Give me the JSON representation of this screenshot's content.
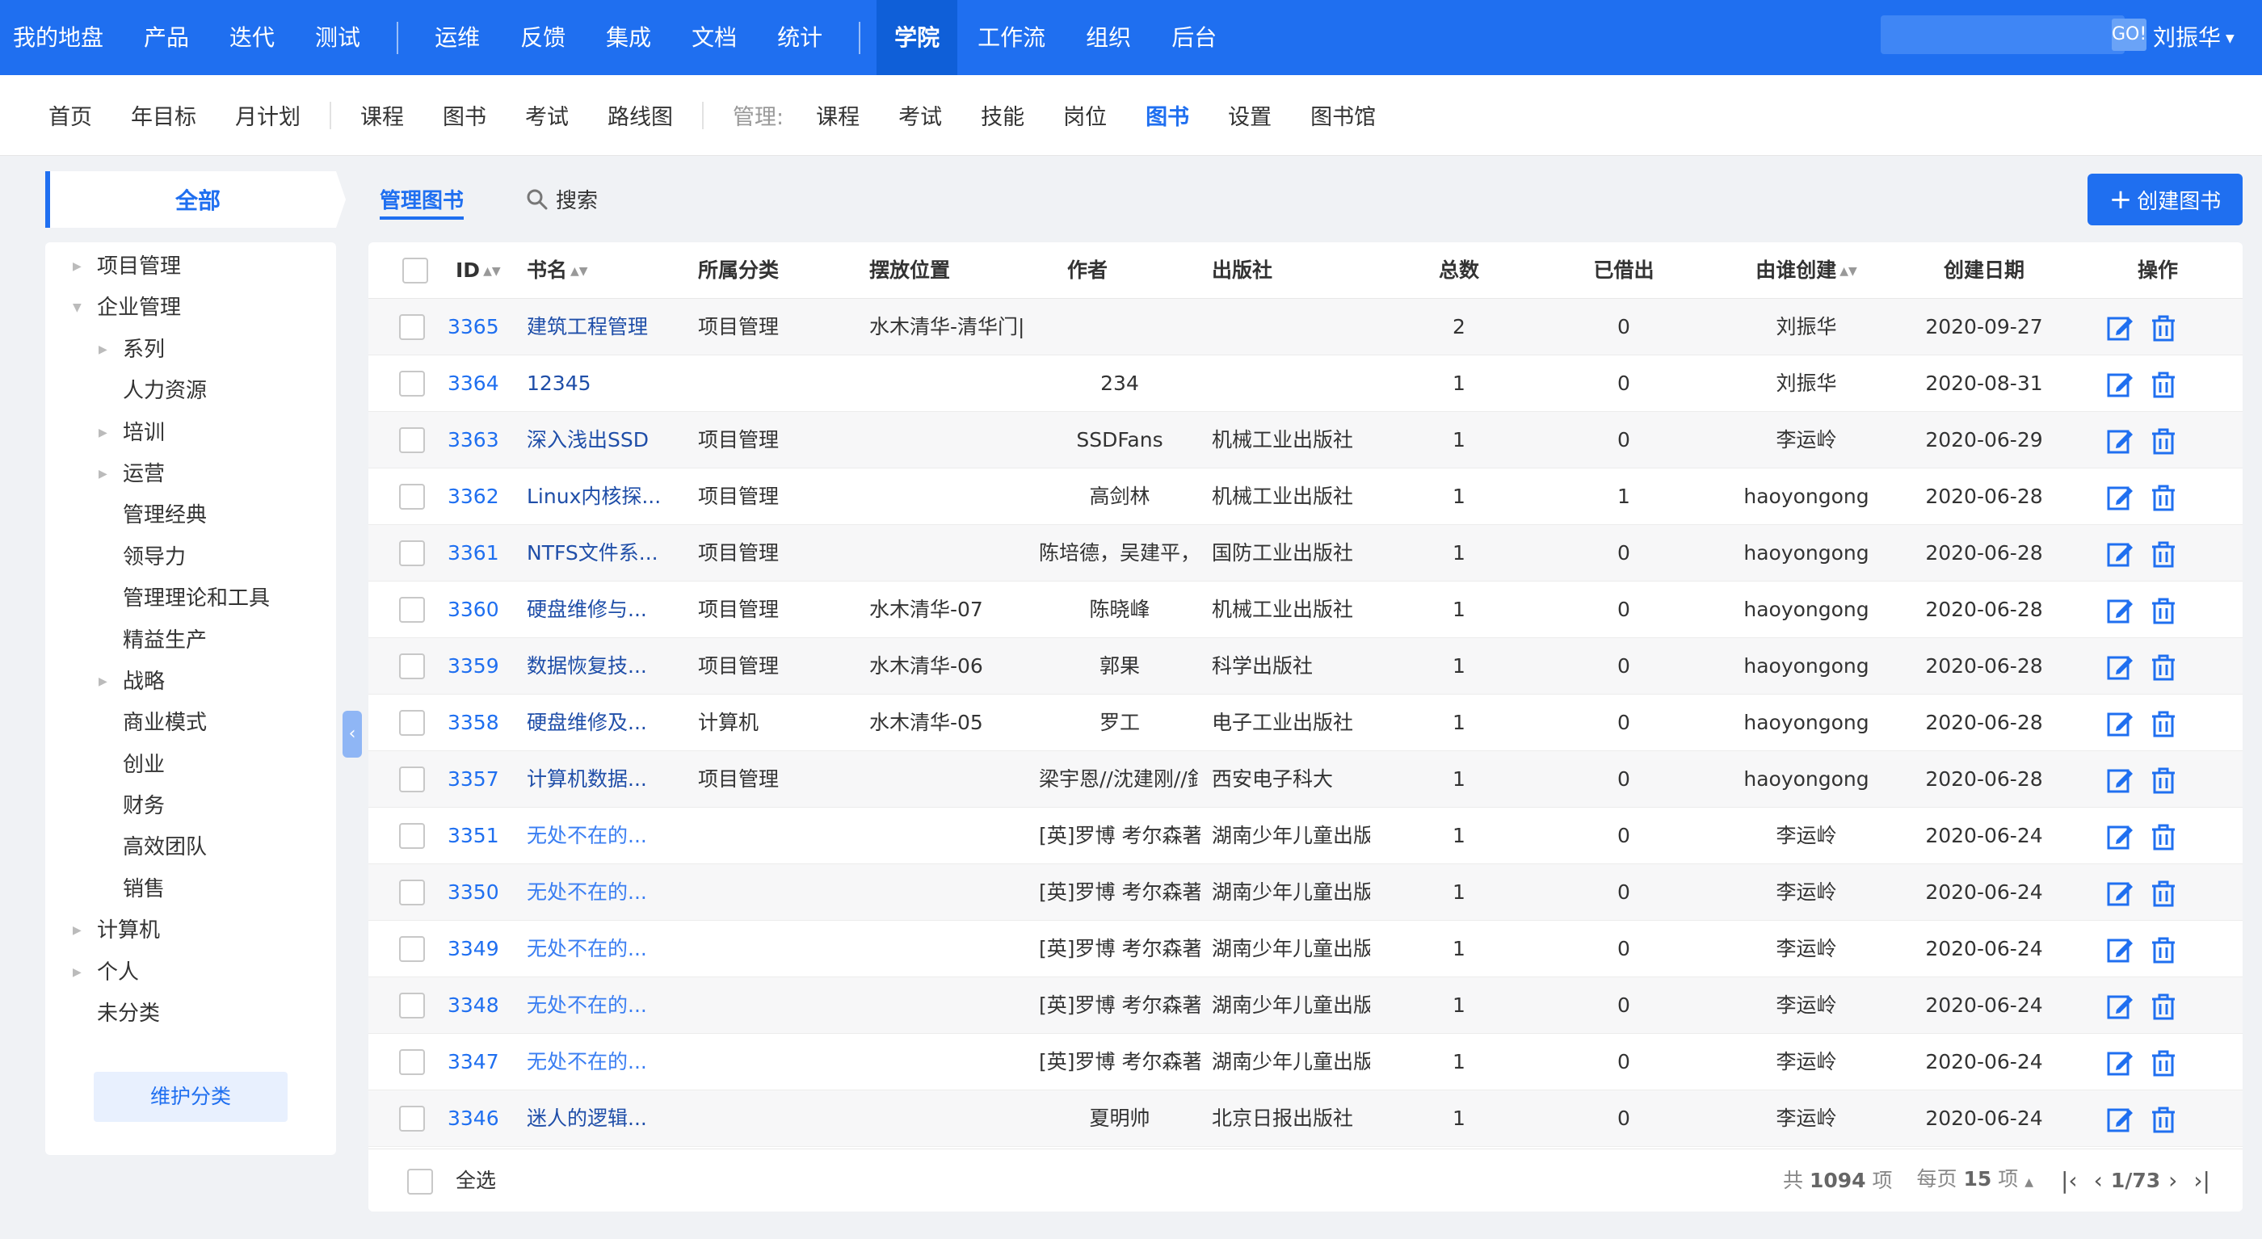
{
  "topnav": {
    "group1": [
      "我的地盘",
      "产品",
      "迭代",
      "测试"
    ],
    "group2": [
      "运维",
      "反馈",
      "集成",
      "文档",
      "统计"
    ],
    "group3": [
      "学院",
      "工作流",
      "组织",
      "后台"
    ],
    "active": "学院",
    "search_button": "GO!",
    "search_value": "",
    "user": "刘振华"
  },
  "subnav": {
    "left": [
      "首页",
      "年目标",
      "月计划"
    ],
    "mid": [
      "课程",
      "图书",
      "考试",
      "路线图"
    ],
    "manage_label": "管理:",
    "manage": [
      "课程",
      "考试",
      "技能",
      "岗位",
      "图书",
      "设置",
      "图书馆"
    ],
    "active": "图书"
  },
  "sidebar": {
    "all_label": "全部",
    "tree": [
      {
        "label": "项目管理",
        "level": 0,
        "arrow": "right"
      },
      {
        "label": "企业管理",
        "level": 0,
        "arrow": "down"
      },
      {
        "label": "系列",
        "level": 1,
        "arrow": "right"
      },
      {
        "label": "人力资源",
        "level": 1,
        "arrow": ""
      },
      {
        "label": "培训",
        "level": 1,
        "arrow": "right"
      },
      {
        "label": "运营",
        "level": 1,
        "arrow": "right"
      },
      {
        "label": "管理经典",
        "level": 1,
        "arrow": ""
      },
      {
        "label": "领导力",
        "level": 1,
        "arrow": ""
      },
      {
        "label": "管理理论和工具",
        "level": 1,
        "arrow": ""
      },
      {
        "label": "精益生产",
        "level": 1,
        "arrow": ""
      },
      {
        "label": "战略",
        "level": 1,
        "arrow": "right"
      },
      {
        "label": "商业模式",
        "level": 1,
        "arrow": ""
      },
      {
        "label": "创业",
        "level": 1,
        "arrow": ""
      },
      {
        "label": "财务",
        "level": 1,
        "arrow": ""
      },
      {
        "label": "高效团队",
        "level": 1,
        "arrow": ""
      },
      {
        "label": "销售",
        "level": 1,
        "arrow": ""
      },
      {
        "label": "计算机",
        "level": 0,
        "arrow": "right"
      },
      {
        "label": "个人",
        "level": 0,
        "arrow": "right"
      },
      {
        "label": "未分类",
        "level": 0,
        "arrow": ""
      }
    ],
    "maintain_button": "维护分类"
  },
  "tabs": {
    "manage": "管理图书",
    "search": "搜索"
  },
  "create_button": "创建图书",
  "table": {
    "headers": {
      "id": "ID",
      "title": "书名",
      "category": "所属分类",
      "location": "摆放位置",
      "author": "作者",
      "publisher": "出版社",
      "total": "总数",
      "borrowed": "已借出",
      "creator": "由谁创建",
      "date": "创建日期",
      "ops": "操作"
    },
    "rows": [
      {
        "id": "3365",
        "title": "建筑工程管理",
        "category": "项目管理",
        "location": "水木清华-清华门|",
        "author": "",
        "publisher": "",
        "total": "2",
        "borrowed": "0",
        "creator": "刘振华",
        "date": "2020-09-27"
      },
      {
        "id": "3364",
        "title": "12345",
        "category": "",
        "location": "",
        "author": "234",
        "publisher": "",
        "total": "1",
        "borrowed": "0",
        "creator": "刘振华",
        "date": "2020-08-31"
      },
      {
        "id": "3363",
        "title": "深入浅出SSD",
        "category": "项目管理",
        "location": "",
        "author": "SSDFans",
        "publisher": "机械工业出版社",
        "total": "1",
        "borrowed": "0",
        "creator": "李运岭",
        "date": "2020-06-29"
      },
      {
        "id": "3362",
        "title": "Linux内核探...",
        "category": "项目管理",
        "location": "",
        "author": "高剑林",
        "publisher": "机械工业出版社",
        "total": "1",
        "borrowed": "1",
        "creator": "haoyongong",
        "date": "2020-06-28"
      },
      {
        "id": "3361",
        "title": "NTFS文件系...",
        "category": "项目管理",
        "location": "",
        "author": "陈培德，吴建平，",
        "publisher": "国防工业出版社",
        "total": "1",
        "borrowed": "0",
        "creator": "haoyongong",
        "date": "2020-06-28"
      },
      {
        "id": "3360",
        "title": "硬盘维修与...",
        "category": "项目管理",
        "location": "水木清华-07",
        "author": "陈晓峰",
        "publisher": "机械工业出版社",
        "total": "1",
        "borrowed": "0",
        "creator": "haoyongong",
        "date": "2020-06-28"
      },
      {
        "id": "3359",
        "title": "数据恢复技...",
        "category": "项目管理",
        "location": "水木清华-06",
        "author": "郭果",
        "publisher": "科学出版社",
        "total": "1",
        "borrowed": "0",
        "creator": "haoyongong",
        "date": "2020-06-28"
      },
      {
        "id": "3358",
        "title": "硬盘维修及...",
        "category": "计算机",
        "location": "水木清华-05",
        "author": "罗工",
        "publisher": "电子工业出版社",
        "total": "1",
        "borrowed": "0",
        "creator": "haoyongong",
        "date": "2020-06-28"
      },
      {
        "id": "3357",
        "title": "计算机数据...",
        "category": "项目管理",
        "location": "",
        "author": "梁宇恩//沈建刚//釒",
        "publisher": "西安电子科大",
        "total": "1",
        "borrowed": "0",
        "creator": "haoyongong",
        "date": "2020-06-28"
      },
      {
        "id": "3351",
        "title": "无处不在的...",
        "category": "",
        "location": "",
        "author": "[英]罗博 考尔森著",
        "publisher": "湖南少年儿童出版",
        "total": "1",
        "borrowed": "0",
        "creator": "李运岭",
        "date": "2020-06-24"
      },
      {
        "id": "3350",
        "title": "无处不在的...",
        "category": "",
        "location": "",
        "author": "[英]罗博 考尔森著",
        "publisher": "湖南少年儿童出版",
        "total": "1",
        "borrowed": "0",
        "creator": "李运岭",
        "date": "2020-06-24"
      },
      {
        "id": "3349",
        "title": "无处不在的...",
        "category": "",
        "location": "",
        "author": "[英]罗博 考尔森著",
        "publisher": "湖南少年儿童出版",
        "total": "1",
        "borrowed": "0",
        "creator": "李运岭",
        "date": "2020-06-24"
      },
      {
        "id": "3348",
        "title": "无处不在的...",
        "category": "",
        "location": "",
        "author": "[英]罗博 考尔森著",
        "publisher": "湖南少年儿童出版",
        "total": "1",
        "borrowed": "0",
        "creator": "李运岭",
        "date": "2020-06-24"
      },
      {
        "id": "3347",
        "title": "无处不在的...",
        "category": "",
        "location": "",
        "author": "[英]罗博 考尔森著",
        "publisher": "湖南少年儿童出版",
        "total": "1",
        "borrowed": "0",
        "creator": "李运岭",
        "date": "2020-06-24"
      },
      {
        "id": "3346",
        "title": "迷人的逻辑...",
        "category": "",
        "location": "",
        "author": "夏明帅",
        "publisher": "北京日报出版社",
        "total": "1",
        "borrowed": "0",
        "creator": "李运岭",
        "date": "2020-06-24"
      }
    ]
  },
  "footer": {
    "select_all": "全选",
    "total_prefix": "共",
    "total": "1094",
    "total_suffix": "项",
    "per_page_prefix": "每页",
    "per_page": "15",
    "per_page_suffix": "项",
    "page": "1/73"
  },
  "colors": {
    "primary": "#1f6ff0",
    "topnav_bg": "#1f6ff0",
    "page_bg": "#f0f2f5"
  },
  "icons": {
    "edit": "edit-icon",
    "delete": "trash-icon",
    "search": "search-icon",
    "plus": "plus-icon",
    "sort": "sort-icon"
  }
}
